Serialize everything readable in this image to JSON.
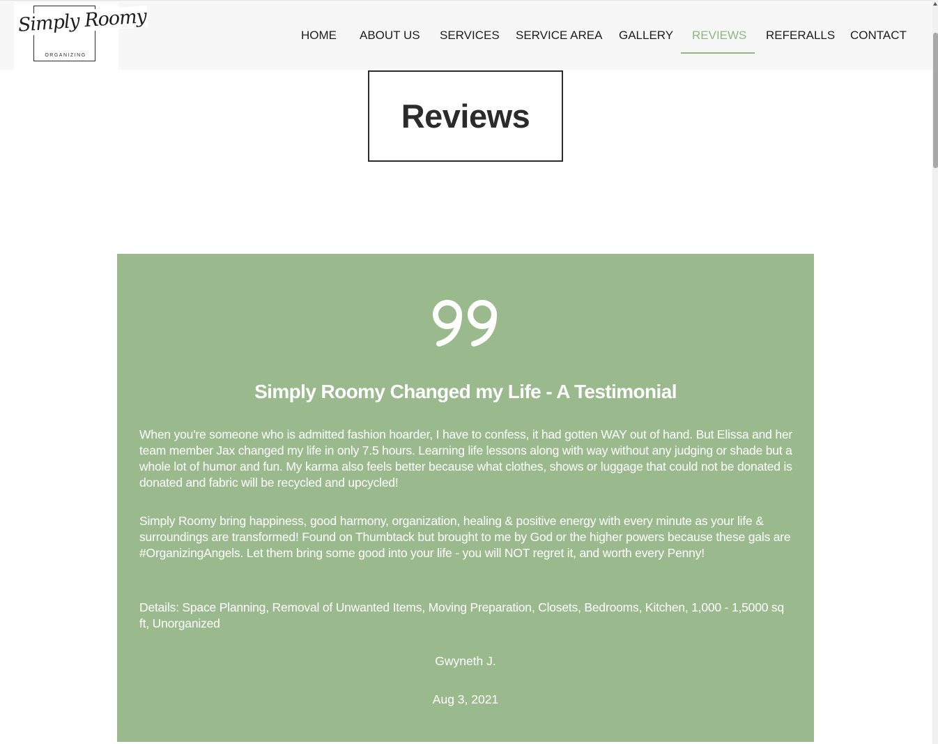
{
  "brand": {
    "logo_script": "Simply Roomy",
    "logo_sub": "ORGANIZING"
  },
  "nav": {
    "items": [
      {
        "label": "HOME",
        "active": false
      },
      {
        "label": "ABOUT US",
        "active": false
      },
      {
        "label": "SERVICES",
        "active": false
      },
      {
        "label": "SERVICE AREA",
        "active": false
      },
      {
        "label": "GALLERY",
        "active": false
      },
      {
        "label": "REVIEWS",
        "active": true
      },
      {
        "label": "REFERALLS",
        "active": false
      },
      {
        "label": "CONTACT",
        "active": false
      }
    ]
  },
  "page": {
    "title": "Reviews"
  },
  "testimonial": {
    "icon": "quote-icon",
    "title": "Simply Roomy Changed my Life - A Testimonial",
    "paragraphs": [
      "When you're someone who is admitted fashion hoarder, I have to confess, it had gotten WAY out of hand. But Elissa and her team member Jax changed my life in only 7.5 hours. Learning life lessons along with way without any judging or shade but a whole lot of humor and fun. My karma also feels better because what clothes, shows or luggage that could not be donated is donated and fabric will be recycled and upcycled!",
      "Simply Roomy bring happiness, good harmony, organization, healing & positive energy with every minute as your life & surroundings are transformed! Found on Thumbtack but brought to me by God or the higher powers because these gals are #OrganizingAngels. Let them bring some good into your life - you will NOT regret it, and worth every Penny!",
      "Details: Space Planning, Removal of Unwanted Items, Moving Preparation, Closets, Bedrooms, Kitchen, 1,000 - 1,5000 sq ft, Unorganized"
    ],
    "author": "Gwyneth J.",
    "date": "Aug 3, 2021"
  },
  "colors": {
    "accent": "#8cb783",
    "card_bg": "#9aba8e",
    "text_dark": "#2b2b2b",
    "header_bg": "#f7f7f7"
  }
}
